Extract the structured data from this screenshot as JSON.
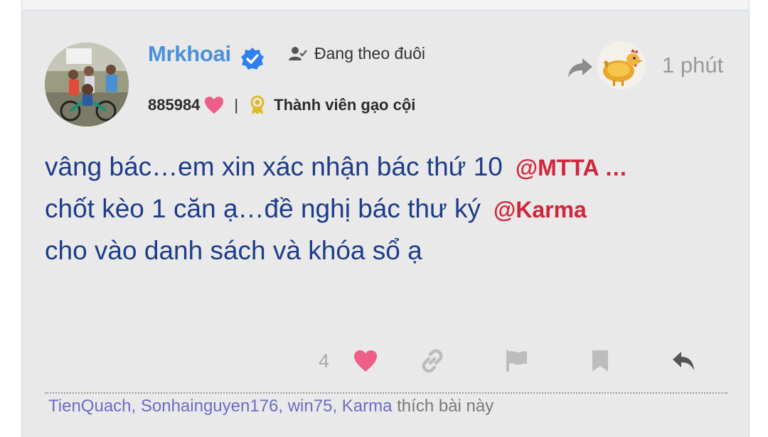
{
  "post": {
    "author": "Mrkhoai",
    "follow_label": "Đang theo đuôi",
    "likes_received": "885984",
    "rank": "Thành viên gạo cội",
    "time": "1 phút",
    "content": {
      "line1_text": "vâng bác…em xin xác nhận bác thứ 10",
      "line1_mention": "@MTTA",
      "line1_tail": " …",
      "line2_text": "chốt kèo 1 căn ạ…đề nghị bác thư ký",
      "line2_mention": "@Karma",
      "line3_text": "cho vào danh sách và khóa sổ ạ"
    },
    "reaction_count": "4",
    "liked_by": [
      "TienQuach",
      "Sonhainguyen176",
      "win75",
      "Karma"
    ],
    "liked_by_suffix": "thích bài này"
  },
  "icons": {
    "verified": "verified-badge-icon",
    "follow": "user-check-icon",
    "heart": "heart-icon",
    "rank": "medal-icon",
    "share": "share-arrow-icon",
    "link": "link-icon",
    "flag": "flag-icon",
    "bookmark": "bookmark-icon",
    "reply": "reply-icon"
  },
  "colors": {
    "username": "#4a90dc",
    "content": "#1d3c8a",
    "mention": "#d2243a",
    "heart": "#ef5e86",
    "liker": "#6c6cc8",
    "verified": "#2f80ed"
  }
}
